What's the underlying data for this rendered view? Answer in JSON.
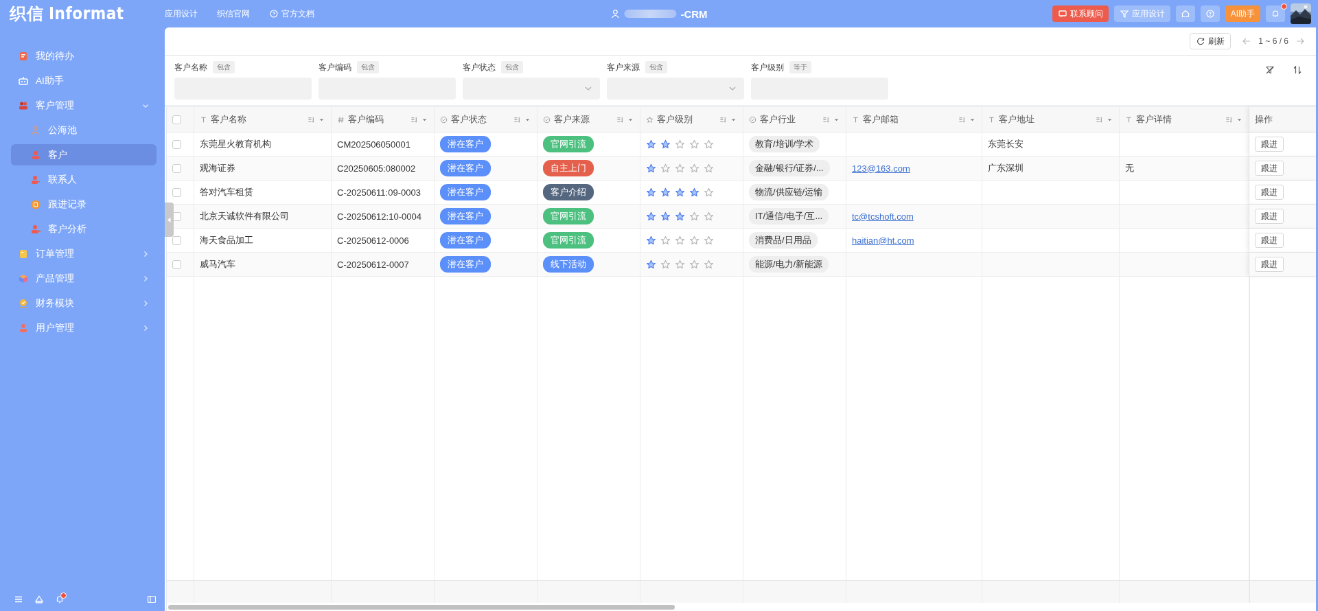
{
  "topbar": {
    "logo": "织信 Informat",
    "nav": [
      {
        "label": "应用设计",
        "kind": "plain"
      },
      {
        "label": "织信官网",
        "kind": "plain"
      },
      {
        "label": "官方文档",
        "kind": "help"
      }
    ],
    "title": "-CRM",
    "actions": [
      {
        "kind": "contact",
        "label": "联系顾问"
      },
      {
        "kind": "design",
        "label": "应用设计"
      },
      {
        "kind": "home"
      },
      {
        "kind": "help"
      },
      {
        "kind": "ai",
        "label": "AI助手"
      },
      {
        "kind": "bell"
      },
      {
        "kind": "avatar"
      }
    ]
  },
  "sidebar": {
    "items": [
      {
        "label": "我的待办",
        "kind": "todo",
        "selected": false
      },
      {
        "label": "AI助手",
        "kind": "robot",
        "selected": false
      },
      {
        "label": "客户管理",
        "kind": "people",
        "selected": false,
        "expanded": true,
        "children": [
          {
            "label": "公海池",
            "kind": "pool",
            "selected": false
          },
          {
            "label": "客户",
            "kind": "person",
            "selected": true
          },
          {
            "label": "联系人",
            "kind": "contact",
            "selected": false
          },
          {
            "label": "跟进记录",
            "kind": "record",
            "selected": false
          },
          {
            "label": "客户分析",
            "kind": "analysis",
            "selected": false
          }
        ]
      },
      {
        "label": "订单管理",
        "kind": "order",
        "selected": false,
        "expanded": false
      },
      {
        "label": "产品管理",
        "kind": "product",
        "selected": false,
        "expanded": false
      },
      {
        "label": "财务模块",
        "kind": "finance",
        "selected": false,
        "expanded": false
      },
      {
        "label": "用户管理",
        "kind": "user",
        "selected": false,
        "expanded": false
      }
    ]
  },
  "toolbar": {
    "refresh": "刷新",
    "pager": "1 ~ 6 / 6"
  },
  "filters": [
    {
      "label": "客户名称",
      "op": "包含",
      "kind": "input"
    },
    {
      "label": "客户编码",
      "op": "包含",
      "kind": "input"
    },
    {
      "label": "客户状态",
      "op": "包含",
      "kind": "select"
    },
    {
      "label": "客户来源",
      "op": "包含",
      "kind": "select"
    },
    {
      "label": "客户级别",
      "op": "等于",
      "kind": "input"
    }
  ],
  "table": {
    "select_all": {
      "checked": false
    },
    "columns": [
      {
        "label": "客户名称",
        "kind": "text"
      },
      {
        "label": "客户编码",
        "kind": "number"
      },
      {
        "label": "客户状态",
        "kind": "option"
      },
      {
        "label": "客户来源",
        "kind": "option"
      },
      {
        "label": "客户级别",
        "kind": "rating"
      },
      {
        "label": "客户行业",
        "kind": "option"
      },
      {
        "label": "客户邮箱",
        "kind": "text"
      },
      {
        "label": "客户地址",
        "kind": "text"
      },
      {
        "label": "客户详情",
        "kind": "text"
      },
      {
        "label": "操作",
        "kind": "action"
      }
    ],
    "rows": [
      {
        "checked": false,
        "name": "东莞星火教育机构",
        "code": "CM202506050001",
        "status": {
          "label": "潜在客户",
          "color": "#5b8ff9"
        },
        "source": {
          "label": "官网引流",
          "color": "#4cc07f"
        },
        "stars": 2,
        "industry": "教育/培训/学术",
        "address": "东莞长安",
        "action": "跟进"
      },
      {
        "checked": false,
        "name": "观海证券",
        "code": "C20250605:080002",
        "status": {
          "label": "潜在客户",
          "color": "#5b8ff9"
        },
        "source": {
          "label": "自主上门",
          "color": "#e4604c"
        },
        "stars": 1,
        "industry": "金融/银行/证券/...",
        "email": "123@163.com",
        "address": "广东深圳",
        "detail": "无",
        "action": "跟进"
      },
      {
        "checked": false,
        "name": "答对汽车租赁",
        "code": "C-20250611:09-0003",
        "status": {
          "label": "潜在客户",
          "color": "#5b8ff9"
        },
        "source": {
          "label": "客户介绍",
          "color": "#55667f"
        },
        "stars": 4,
        "industry": "物流/供应链/运输",
        "action": "跟进"
      },
      {
        "checked": false,
        "name": "北京天诚软件有限公司",
        "code": "C-20250612:10-0004",
        "status": {
          "label": "潜在客户",
          "color": "#5b8ff9"
        },
        "source": {
          "label": "官网引流",
          "color": "#4cc07f"
        },
        "stars": 3,
        "industry": "IT/通信/电子/互...",
        "email": "tc@tcshoft.com",
        "action": "跟进"
      },
      {
        "checked": false,
        "name": "海天食品加工",
        "code": "C-20250612-0006",
        "status": {
          "label": "潜在客户",
          "color": "#5b8ff9"
        },
        "source": {
          "label": "官网引流",
          "color": "#4cc07f"
        },
        "stars": 1,
        "industry": "消费品/日用品",
        "email": "haitian@ht.com",
        "action": "跟进"
      },
      {
        "checked": false,
        "name": "威马汽车",
        "code": "C-20250612-0007",
        "status": {
          "label": "潜在客户",
          "color": "#5b8ff9"
        },
        "source": {
          "label": "线下活动",
          "color": "#5b8ff9"
        },
        "stars": 1,
        "industry": "能源/电力/新能源",
        "action": "跟进"
      }
    ]
  }
}
